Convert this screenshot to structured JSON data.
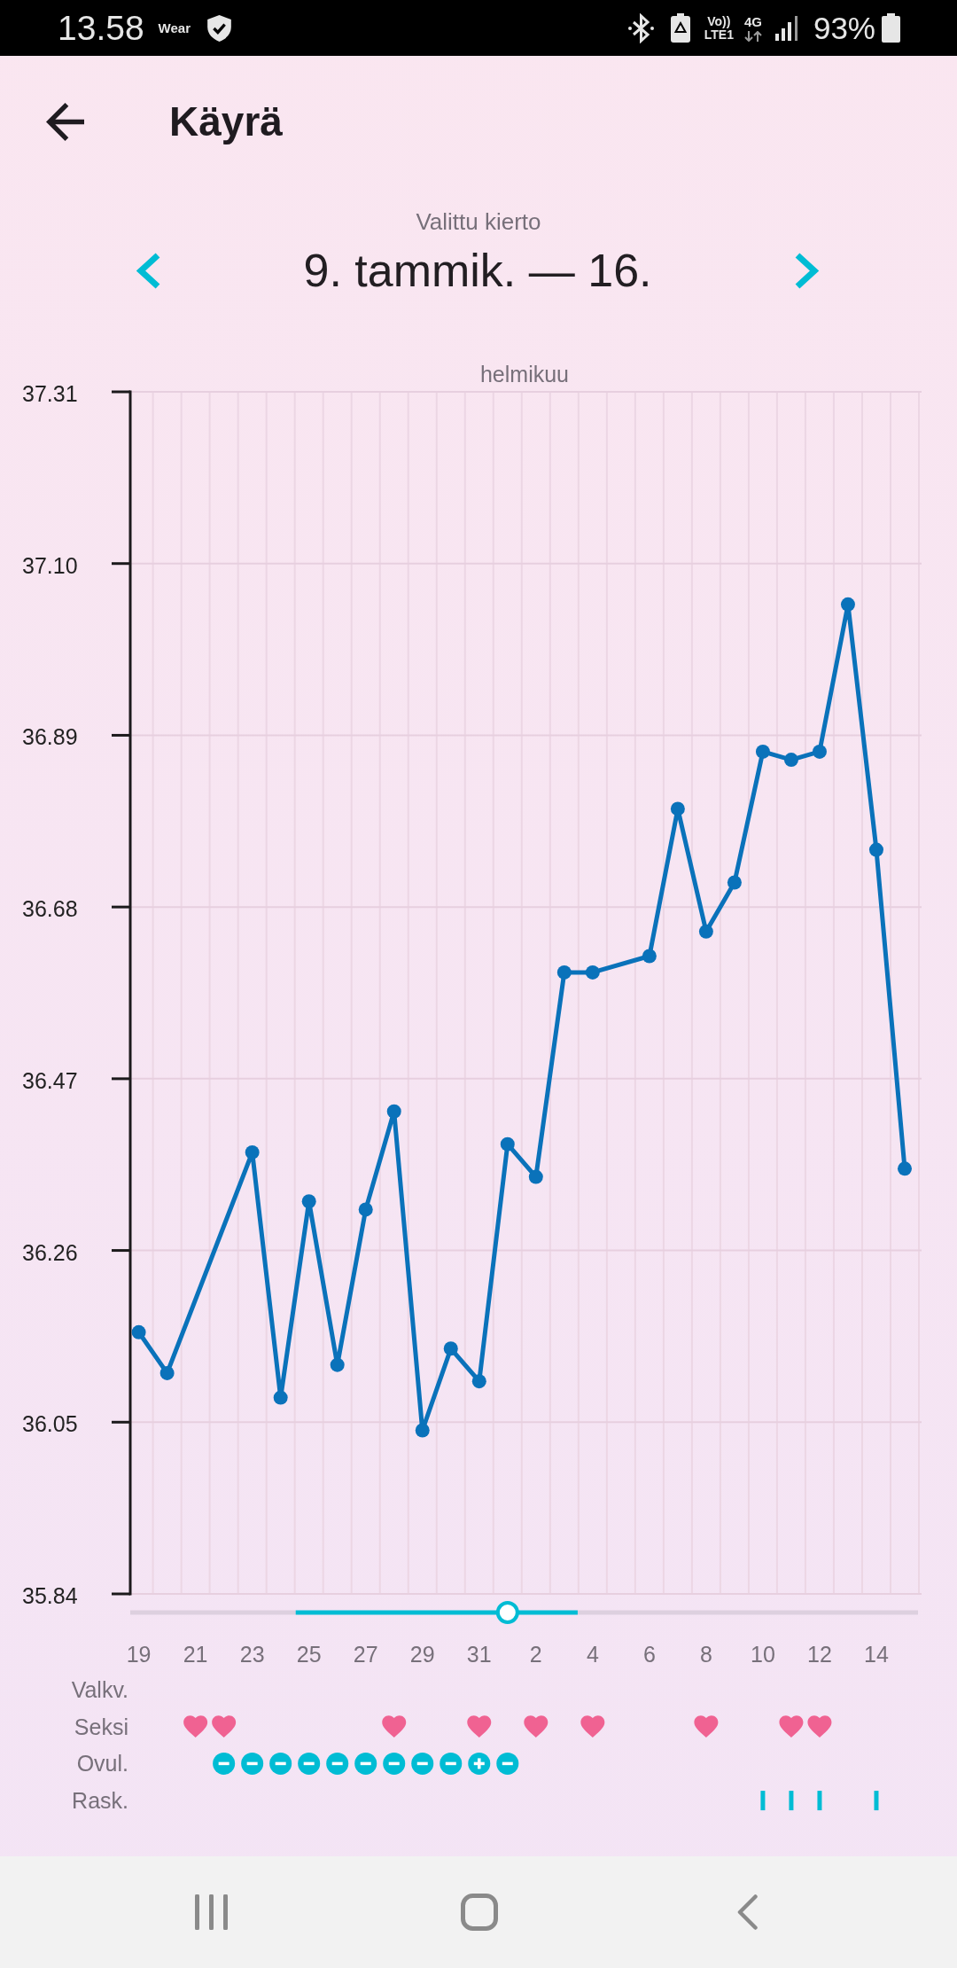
{
  "status_bar": {
    "time": "13.58",
    "wear_label": "Wear",
    "volte_top": "Vo))",
    "volte_bottom": "LTE1",
    "network": "4G",
    "battery": "93%"
  },
  "header": {
    "title": "Käyrä"
  },
  "cycle_selector": {
    "caption": "Valittu kierto",
    "range": "9. tammik. — 16."
  },
  "chart": {
    "chart_data": {
      "type": "line",
      "title": "helmikuu",
      "grid": true,
      "marker": "circle",
      "categories": [
        "19",
        null,
        "21",
        null,
        "23",
        null,
        "25",
        null,
        "27",
        null,
        "29",
        null,
        "31",
        null,
        "2",
        null,
        "4",
        null,
        "6",
        null,
        "8",
        null,
        "10",
        null,
        "12",
        null,
        "14",
        null
      ],
      "values": [
        36.16,
        36.11,
        null,
        null,
        36.38,
        36.08,
        36.32,
        36.12,
        36.31,
        36.43,
        36.04,
        36.14,
        36.1,
        36.39,
        36.35,
        36.6,
        36.6,
        null,
        36.62,
        36.8,
        36.65,
        36.71,
        36.87,
        36.86,
        36.87,
        37.05,
        36.75,
        36.36
      ],
      "ylim": [
        35.84,
        37.31
      ],
      "yticks": [
        {
          "value": 35.84,
          "label": "35.84"
        },
        {
          "value": 36.05,
          "label": "36.05"
        },
        {
          "value": 36.26,
          "label": "36.26"
        },
        {
          "value": 36.47,
          "label": "36.47"
        },
        {
          "value": 36.68,
          "label": "36.68"
        },
        {
          "value": 36.89,
          "label": "36.89"
        },
        {
          "value": 37.1,
          "label": "37.10"
        },
        {
          "value": 37.31,
          "label": "37.31"
        }
      ]
    },
    "slider": {
      "level": 0.479,
      "segments": [
        {
          "level": 0.21,
          "highlighted": false
        },
        {
          "level": 0.358,
          "highlighted": true
        },
        {
          "level": 0.432,
          "highlighted": false
        }
      ]
    },
    "tracks": [
      {
        "label": "Valkv."
      },
      {
        "label": "Seksi",
        "days": [
          {
            "kind": "empty"
          },
          {
            "kind": "empty"
          },
          {
            "kind": "heart"
          },
          {
            "kind": "heart"
          },
          {
            "kind": "empty"
          },
          {
            "kind": "empty"
          },
          {
            "kind": "empty"
          },
          {
            "kind": "empty"
          },
          {
            "kind": "empty"
          },
          {
            "kind": "heart"
          },
          {
            "kind": "empty"
          },
          {
            "kind": "empty"
          },
          {
            "kind": "heart"
          },
          {
            "kind": "empty"
          },
          {
            "kind": "heart"
          },
          {
            "kind": "empty"
          },
          {
            "kind": "heart"
          },
          {
            "kind": "empty"
          },
          {
            "kind": "empty"
          },
          {
            "kind": "empty"
          },
          {
            "kind": "heart"
          },
          {
            "kind": "empty"
          },
          {
            "kind": "empty"
          },
          {
            "kind": "heart"
          },
          {
            "kind": "heart"
          },
          {
            "kind": "empty"
          },
          {
            "kind": "empty"
          },
          {
            "kind": "empty"
          }
        ]
      },
      {
        "label": "Ovul.",
        "days": [
          {
            "kind": "empty"
          },
          {
            "kind": "empty"
          },
          {
            "kind": "empty"
          },
          {
            "kind": "negative_test"
          },
          {
            "kind": "negative_test"
          },
          {
            "kind": "negative_test"
          },
          {
            "kind": "negative_test"
          },
          {
            "kind": "negative_test"
          },
          {
            "kind": "negative_test"
          },
          {
            "kind": "negative_test"
          },
          {
            "kind": "negative_test"
          },
          {
            "kind": "negative_test"
          },
          {
            "kind": "positive_test"
          },
          {
            "kind": "negative_test"
          },
          {
            "kind": "empty"
          },
          {
            "kind": "empty"
          },
          {
            "kind": "empty"
          },
          {
            "kind": "empty"
          },
          {
            "kind": "empty"
          },
          {
            "kind": "empty"
          },
          {
            "kind": "empty"
          },
          {
            "kind": "empty"
          },
          {
            "kind": "empty"
          },
          {
            "kind": "empty"
          },
          {
            "kind": "empty"
          },
          {
            "kind": "empty"
          },
          {
            "kind": "empty"
          },
          {
            "kind": "empty"
          }
        ]
      },
      {
        "label": "Rask.",
        "days": [
          {
            "kind": "empty"
          },
          {
            "kind": "empty"
          },
          {
            "kind": "empty"
          },
          {
            "kind": "empty"
          },
          {
            "kind": "empty"
          },
          {
            "kind": "empty"
          },
          {
            "kind": "empty"
          },
          {
            "kind": "empty"
          },
          {
            "kind": "empty"
          },
          {
            "kind": "empty"
          },
          {
            "kind": "empty"
          },
          {
            "kind": "empty"
          },
          {
            "kind": "empty"
          },
          {
            "kind": "empty"
          },
          {
            "kind": "empty"
          },
          {
            "kind": "empty"
          },
          {
            "kind": "empty"
          },
          {
            "kind": "empty"
          },
          {
            "kind": "empty"
          },
          {
            "kind": "empty"
          },
          {
            "kind": "empty"
          },
          {
            "kind": "empty"
          },
          {
            "kind": "bar"
          },
          {
            "kind": "bar"
          },
          {
            "kind": "bar"
          },
          {
            "kind": "empty"
          },
          {
            "kind": "bar"
          },
          {
            "kind": "empty"
          }
        ]
      }
    ]
  }
}
